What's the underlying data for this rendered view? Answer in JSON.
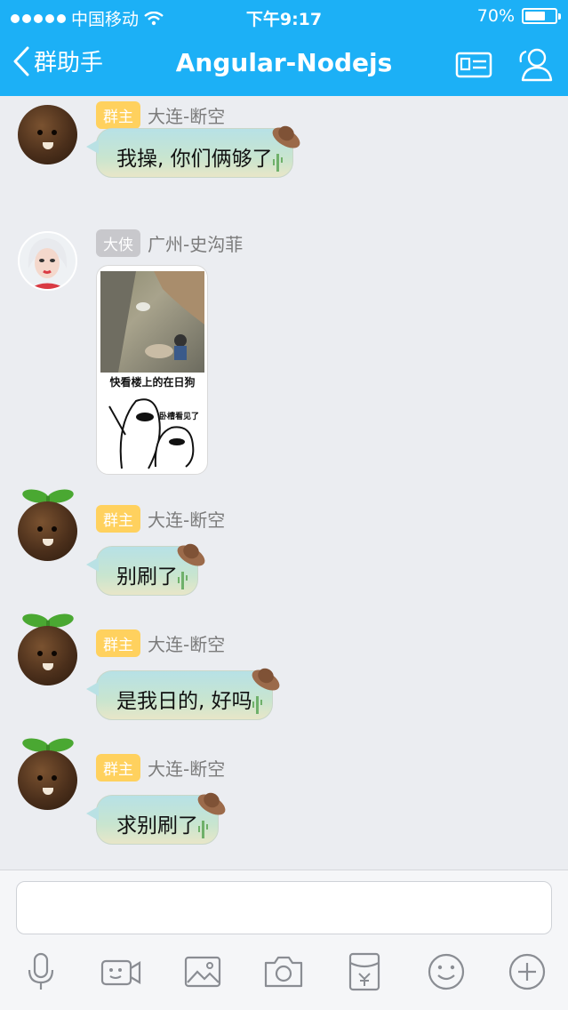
{
  "status_bar": {
    "carrier": "中国移动",
    "time": "下午9:17",
    "battery_percent": "70%",
    "battery_level": 0.7
  },
  "nav": {
    "back_label": "群助手",
    "title": "Angular-Nodejs",
    "right_icons": [
      "profile-card-icon",
      "group-members-icon"
    ]
  },
  "messages": [
    {
      "role_badge": "群主",
      "sender": "大连-断空",
      "text": "我操, 你们俩够了"
    },
    {
      "role_badge": "大侠",
      "sender": "广州-史沟菲",
      "image_caption": "快看楼上的在日狗",
      "image_caption_2": "卧槽看见了"
    },
    {
      "role_badge": "群主",
      "sender": "大连-断空",
      "text": "别刷了"
    },
    {
      "role_badge": "群主",
      "sender": "大连-断空",
      "text": "是我日的, 好吗"
    },
    {
      "role_badge": "群主",
      "sender": "大连-断空",
      "text": "求别刷了"
    }
  ],
  "input": {
    "placeholder": "",
    "tools": [
      "microphone-icon",
      "video-call-icon",
      "image-icon",
      "camera-icon",
      "red-packet-icon",
      "emoji-icon",
      "plus-icon"
    ]
  },
  "colors": {
    "header": "#1cb0f6",
    "owner_badge": "#ffd15e",
    "hero_badge": "#c8c8cc",
    "background": "#ebedf1"
  }
}
